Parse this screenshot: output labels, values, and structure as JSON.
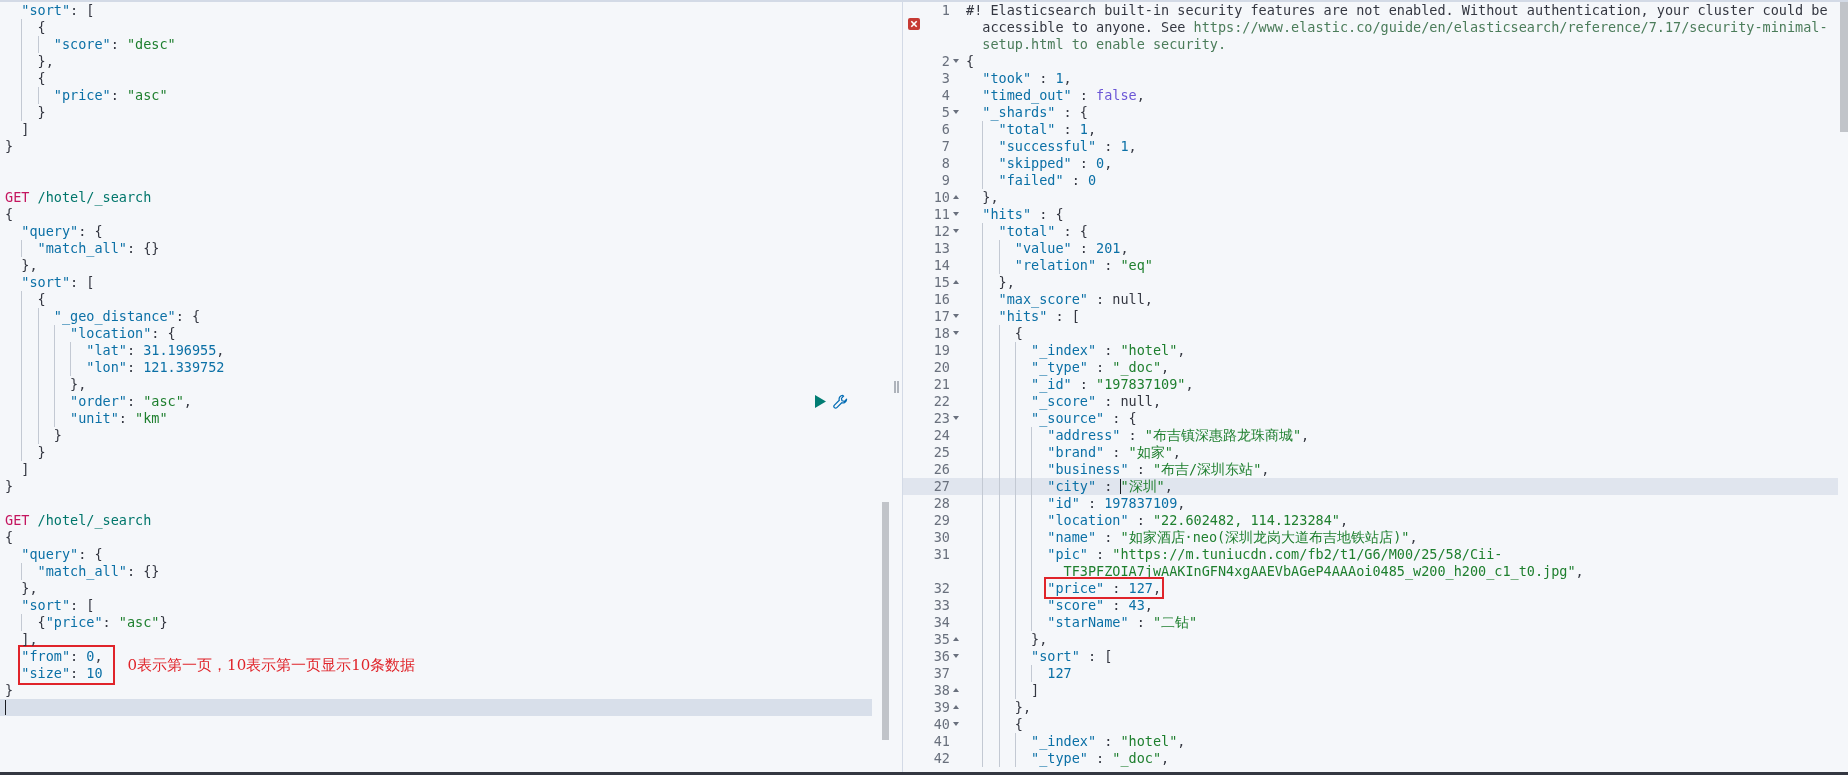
{
  "request_editor": {
    "note": "0表示第一页，10表示第一页显示10条数据",
    "lines": [
      {
        "current": false,
        "tokens": [
          {
            "kind": "key",
            "text": "  \"sort\""
          },
          {
            "kind": "punct",
            "text": ": ["
          }
        ]
      },
      {
        "current": false,
        "tokens": [
          {
            "kind": "punct",
            "text": "    {"
          }
        ]
      },
      {
        "current": false,
        "tokens": [
          {
            "kind": "key",
            "text": "      \"score\""
          },
          {
            "kind": "punct",
            "text": ": "
          },
          {
            "kind": "string",
            "text": "\"desc\""
          }
        ]
      },
      {
        "current": false,
        "tokens": [
          {
            "kind": "punct",
            "text": "    },"
          }
        ]
      },
      {
        "current": false,
        "tokens": [
          {
            "kind": "punct",
            "text": "    {"
          }
        ]
      },
      {
        "current": false,
        "tokens": [
          {
            "kind": "key",
            "text": "      \"price\""
          },
          {
            "kind": "punct",
            "text": ": "
          },
          {
            "kind": "string",
            "text": "\"asc\""
          }
        ]
      },
      {
        "current": false,
        "tokens": [
          {
            "kind": "punct",
            "text": "    }"
          }
        ]
      },
      {
        "current": false,
        "tokens": [
          {
            "kind": "punct",
            "text": "  ]"
          }
        ]
      },
      {
        "current": false,
        "tokens": [
          {
            "kind": "punct",
            "text": "}"
          }
        ]
      },
      {
        "current": false
      },
      {
        "current": false
      },
      {
        "current": false,
        "tokens": [
          {
            "kind": "method",
            "text": "GET"
          },
          {
            "kind": "path",
            "text": " /hotel/_search"
          }
        ]
      },
      {
        "current": false,
        "tokens": [
          {
            "kind": "punct",
            "text": "{"
          }
        ]
      },
      {
        "current": false,
        "tokens": [
          {
            "kind": "key",
            "text": "  \"query\""
          },
          {
            "kind": "punct",
            "text": ": {"
          }
        ]
      },
      {
        "current": false,
        "tokens": [
          {
            "kind": "key",
            "text": "    \"match_all\""
          },
          {
            "kind": "punct",
            "text": ": {}"
          }
        ]
      },
      {
        "current": false,
        "tokens": [
          {
            "kind": "punct",
            "text": "  },"
          }
        ]
      },
      {
        "current": false,
        "tokens": [
          {
            "kind": "key",
            "text": "  \"sort\""
          },
          {
            "kind": "punct",
            "text": ": ["
          }
        ]
      },
      {
        "current": false,
        "tokens": [
          {
            "kind": "punct",
            "text": "    {"
          }
        ]
      },
      {
        "current": false,
        "tokens": [
          {
            "kind": "key",
            "text": "      \"_geo_distance\""
          },
          {
            "kind": "punct",
            "text": ": {"
          }
        ]
      },
      {
        "current": false,
        "tokens": [
          {
            "kind": "key",
            "text": "        \"location\""
          },
          {
            "kind": "punct",
            "text": ": {"
          }
        ]
      },
      {
        "current": false,
        "tokens": [
          {
            "kind": "key",
            "text": "          \"lat\""
          },
          {
            "kind": "punct",
            "text": ": "
          },
          {
            "kind": "number",
            "text": "31.196955"
          },
          {
            "kind": "punct",
            "text": ","
          }
        ]
      },
      {
        "current": false,
        "tokens": [
          {
            "kind": "key",
            "text": "          \"lon\""
          },
          {
            "kind": "punct",
            "text": ": "
          },
          {
            "kind": "number",
            "text": "121.339752"
          }
        ]
      },
      {
        "current": false,
        "tokens": [
          {
            "kind": "punct",
            "text": "        },"
          }
        ]
      },
      {
        "current": false,
        "actions": true,
        "tokens": [
          {
            "kind": "key",
            "text": "        \"order\""
          },
          {
            "kind": "punct",
            "text": ": "
          },
          {
            "kind": "string",
            "text": "\"asc\""
          },
          {
            "kind": "punct",
            "text": ","
          }
        ]
      },
      {
        "current": false,
        "tokens": [
          {
            "kind": "key",
            "text": "        \"unit\""
          },
          {
            "kind": "punct",
            "text": ": "
          },
          {
            "kind": "string",
            "text": "\"km\""
          }
        ]
      },
      {
        "current": false,
        "tokens": [
          {
            "kind": "punct",
            "text": "      }"
          }
        ]
      },
      {
        "current": false,
        "tokens": [
          {
            "kind": "punct",
            "text": "    }"
          }
        ]
      },
      {
        "current": false,
        "tokens": [
          {
            "kind": "punct",
            "text": "  ]"
          }
        ]
      },
      {
        "current": false,
        "tokens": [
          {
            "kind": "punct",
            "text": "}"
          }
        ]
      },
      {
        "current": false
      },
      {
        "current": false,
        "tokens": [
          {
            "kind": "method",
            "text": "GET"
          },
          {
            "kind": "path",
            "text": " /hotel/_search"
          }
        ]
      },
      {
        "current": false,
        "tokens": [
          {
            "kind": "punct",
            "text": "{"
          }
        ]
      },
      {
        "current": false,
        "tokens": [
          {
            "kind": "key",
            "text": "  \"query\""
          },
          {
            "kind": "punct",
            "text": ": {"
          }
        ]
      },
      {
        "current": false,
        "tokens": [
          {
            "kind": "key",
            "text": "    \"match_all\""
          },
          {
            "kind": "punct",
            "text": ": {}"
          }
        ]
      },
      {
        "current": false,
        "tokens": [
          {
            "kind": "punct",
            "text": "  },"
          }
        ]
      },
      {
        "current": false,
        "tokens": [
          {
            "kind": "key",
            "text": "  \"sort\""
          },
          {
            "kind": "punct",
            "text": ": ["
          }
        ]
      },
      {
        "current": false,
        "tokens": [
          {
            "kind": "punct",
            "text": "    {"
          },
          {
            "kind": "key",
            "text": "\"price\""
          },
          {
            "kind": "punct",
            "text": ": "
          },
          {
            "kind": "string",
            "text": "\"asc\""
          },
          {
            "kind": "punct",
            "text": "}"
          }
        ]
      },
      {
        "current": false,
        "tokens": [
          {
            "kind": "punct",
            "text": "  ],"
          }
        ]
      },
      {
        "current": false,
        "marked": true,
        "tokens": [
          {
            "kind": "key",
            "text": "  \"from\""
          },
          {
            "kind": "punct",
            "text": ": "
          },
          {
            "kind": "number",
            "text": "0"
          },
          {
            "kind": "punct",
            "text": ","
          }
        ]
      },
      {
        "current": false,
        "marked": true,
        "tokens": [
          {
            "kind": "key",
            "text": "  \"size\""
          },
          {
            "kind": "punct",
            "text": ": "
          },
          {
            "kind": "number",
            "text": "10"
          }
        ]
      },
      {
        "current": false,
        "tokens": [
          {
            "kind": "punct",
            "text": "}"
          }
        ]
      },
      {
        "current": true
      }
    ]
  },
  "response_viewer": {
    "lines": [
      {
        "number": "1",
        "current": false,
        "error": true,
        "tokens": [
          {
            "kind": "plain",
            "text": "#! Elasticsearch built-in security features are not enabled. Without authentication, your cluster could be accessible to anyone. See "
          },
          {
            "kind": "link",
            "text": "https://www.elastic.co/guide/en/elasticsearch/reference/7.17/security-minimal-setup.html to enable security."
          }
        ]
      },
      {
        "number": "2",
        "current": false,
        "fold_start": true,
        "tokens": [
          {
            "kind": "punct",
            "text": "{"
          }
        ]
      },
      {
        "number": "3",
        "current": false,
        "tokens": [
          {
            "kind": "key",
            "text": "  \"took\""
          },
          {
            "kind": "punct",
            "text": " : "
          },
          {
            "kind": "number",
            "text": "1"
          },
          {
            "kind": "punct",
            "text": ","
          }
        ]
      },
      {
        "number": "4",
        "current": false,
        "tokens": [
          {
            "kind": "key",
            "text": "  \"timed_out\""
          },
          {
            "kind": "punct",
            "text": " : "
          },
          {
            "kind": "bool",
            "text": "false"
          },
          {
            "kind": "punct",
            "text": ","
          }
        ]
      },
      {
        "number": "5",
        "current": false,
        "fold_start": true,
        "tokens": [
          {
            "kind": "key",
            "text": "  \"_shards\""
          },
          {
            "kind": "punct",
            "text": " : {"
          }
        ]
      },
      {
        "number": "6",
        "current": false,
        "tokens": [
          {
            "kind": "key",
            "text": "    \"total\""
          },
          {
            "kind": "punct",
            "text": " : "
          },
          {
            "kind": "number",
            "text": "1"
          },
          {
            "kind": "punct",
            "text": ","
          }
        ]
      },
      {
        "number": "7",
        "current": false,
        "tokens": [
          {
            "kind": "key",
            "text": "    \"successful\""
          },
          {
            "kind": "punct",
            "text": " : "
          },
          {
            "kind": "number",
            "text": "1"
          },
          {
            "kind": "punct",
            "text": ","
          }
        ]
      },
      {
        "number": "8",
        "current": false,
        "tokens": [
          {
            "kind": "key",
            "text": "    \"skipped\""
          },
          {
            "kind": "punct",
            "text": " : "
          },
          {
            "kind": "number",
            "text": "0"
          },
          {
            "kind": "punct",
            "text": ","
          }
        ]
      },
      {
        "number": "9",
        "current": false,
        "tokens": [
          {
            "kind": "key",
            "text": "    \"failed\""
          },
          {
            "kind": "punct",
            "text": " : "
          },
          {
            "kind": "number",
            "text": "0"
          }
        ]
      },
      {
        "number": "10",
        "current": false,
        "fold_end": true,
        "tokens": [
          {
            "kind": "punct",
            "text": "  },"
          }
        ]
      },
      {
        "number": "11",
        "current": false,
        "fold_start": true,
        "tokens": [
          {
            "kind": "key",
            "text": "  \"hits\""
          },
          {
            "kind": "punct",
            "text": " : {"
          }
        ]
      },
      {
        "number": "12",
        "current": false,
        "fold_start": true,
        "tokens": [
          {
            "kind": "key",
            "text": "    \"total\""
          },
          {
            "kind": "punct",
            "text": " : {"
          }
        ]
      },
      {
        "number": "13",
        "current": false,
        "tokens": [
          {
            "kind": "key",
            "text": "      \"value\""
          },
          {
            "kind": "punct",
            "text": " : "
          },
          {
            "kind": "number",
            "text": "201"
          },
          {
            "kind": "punct",
            "text": ","
          }
        ]
      },
      {
        "number": "14",
        "current": false,
        "tokens": [
          {
            "kind": "key",
            "text": "      \"relation\""
          },
          {
            "kind": "punct",
            "text": " : "
          },
          {
            "kind": "string",
            "text": "\"eq\""
          }
        ]
      },
      {
        "number": "15",
        "current": false,
        "fold_end": true,
        "tokens": [
          {
            "kind": "punct",
            "text": "    },"
          }
        ]
      },
      {
        "number": "16",
        "current": false,
        "tokens": [
          {
            "kind": "key",
            "text": "    \"max_score\""
          },
          {
            "kind": "punct",
            "text": " : null,"
          }
        ]
      },
      {
        "number": "17",
        "current": false,
        "fold_start": true,
        "tokens": [
          {
            "kind": "key",
            "text": "    \"hits\""
          },
          {
            "kind": "punct",
            "text": " : ["
          }
        ]
      },
      {
        "number": "18",
        "current": false,
        "fold_start": true,
        "tokens": [
          {
            "kind": "punct",
            "text": "      {"
          }
        ]
      },
      {
        "number": "19",
        "current": false,
        "tokens": [
          {
            "kind": "key",
            "text": "        \"_index\""
          },
          {
            "kind": "punct",
            "text": " : "
          },
          {
            "kind": "string",
            "text": "\"hotel\""
          },
          {
            "kind": "punct",
            "text": ","
          }
        ]
      },
      {
        "number": "20",
        "current": false,
        "tokens": [
          {
            "kind": "key",
            "text": "        \"_type\""
          },
          {
            "kind": "punct",
            "text": " : "
          },
          {
            "kind": "string",
            "text": "\"_doc\""
          },
          {
            "kind": "punct",
            "text": ","
          }
        ]
      },
      {
        "number": "21",
        "current": false,
        "tokens": [
          {
            "kind": "key",
            "text": "        \"_id\""
          },
          {
            "kind": "punct",
            "text": " : "
          },
          {
            "kind": "string",
            "text": "\"197837109\""
          },
          {
            "kind": "punct",
            "text": ","
          }
        ]
      },
      {
        "number": "22",
        "current": false,
        "tokens": [
          {
            "kind": "key",
            "text": "        \"_score\""
          },
          {
            "kind": "punct",
            "text": " : null,"
          }
        ]
      },
      {
        "number": "23",
        "current": false,
        "fold_start": true,
        "tokens": [
          {
            "kind": "key",
            "text": "        \"_source\""
          },
          {
            "kind": "punct",
            "text": " : {"
          }
        ]
      },
      {
        "number": "24",
        "current": false,
        "tokens": [
          {
            "kind": "key",
            "text": "          \"address\""
          },
          {
            "kind": "punct",
            "text": " : "
          },
          {
            "kind": "string",
            "text": "\"布吉镇深惠路龙珠商城\""
          },
          {
            "kind": "punct",
            "text": ","
          }
        ]
      },
      {
        "number": "25",
        "current": false,
        "tokens": [
          {
            "kind": "key",
            "text": "          \"brand\""
          },
          {
            "kind": "punct",
            "text": " : "
          },
          {
            "kind": "string",
            "text": "\"如家\""
          },
          {
            "kind": "punct",
            "text": ","
          }
        ]
      },
      {
        "number": "26",
        "current": false,
        "tokens": [
          {
            "kind": "key",
            "text": "          \"business\""
          },
          {
            "kind": "punct",
            "text": " : "
          },
          {
            "kind": "string",
            "text": "\"布吉/深圳东站\""
          },
          {
            "kind": "punct",
            "text": ","
          }
        ]
      },
      {
        "number": "27",
        "current": true,
        "tokens": [
          {
            "kind": "key",
            "text": "          \"city\""
          },
          {
            "kind": "punct",
            "text": " : "
          },
          {
            "kind": "string",
            "text": "\"深圳\"",
            "cursor": true
          },
          {
            "kind": "punct",
            "text": ","
          }
        ]
      },
      {
        "number": "28",
        "current": false,
        "tokens": [
          {
            "kind": "key",
            "text": "          \"id\""
          },
          {
            "kind": "punct",
            "text": " : "
          },
          {
            "kind": "number",
            "text": "197837109"
          },
          {
            "kind": "punct",
            "text": ","
          }
        ]
      },
      {
        "number": "29",
        "current": false,
        "tokens": [
          {
            "kind": "key",
            "text": "          \"location\""
          },
          {
            "kind": "punct",
            "text": " : "
          },
          {
            "kind": "string",
            "text": "\"22.602482, 114.123284\""
          },
          {
            "kind": "punct",
            "text": ","
          }
        ]
      },
      {
        "number": "30",
        "current": false,
        "tokens": [
          {
            "kind": "key",
            "text": "          \"name\""
          },
          {
            "kind": "punct",
            "text": " : "
          },
          {
            "kind": "string",
            "text": "\"如家酒店·neo(深圳龙岗大道布吉地铁站店)\""
          },
          {
            "kind": "punct",
            "text": ","
          }
        ]
      },
      {
        "number": "31",
        "current": false,
        "tokens": [
          {
            "kind": "key",
            "text": "          \"pic\""
          },
          {
            "kind": "punct",
            "text": " : "
          },
          {
            "kind": "string",
            "text": "\"https://m.tuniucdn.com/fb2/t1/G6/M00/25/58/Cii-TF3PFZOIA7jwAAKInGFN4xgAAEVbAGeP4AAAoi0485_w200_h200_c1_t0.jpg\""
          },
          {
            "kind": "punct",
            "text": ","
          }
        ]
      },
      {
        "number": "32",
        "current": false,
        "marked": true,
        "tokens": [
          {
            "kind": "key",
            "text": "          \"price\""
          },
          {
            "kind": "punct",
            "text": " : "
          },
          {
            "kind": "number",
            "text": "127"
          },
          {
            "kind": "punct",
            "text": ","
          }
        ]
      },
      {
        "number": "33",
        "current": false,
        "tokens": [
          {
            "kind": "key",
            "text": "          \"score\""
          },
          {
            "kind": "punct",
            "text": " : "
          },
          {
            "kind": "number",
            "text": "43"
          },
          {
            "kind": "punct",
            "text": ","
          }
        ]
      },
      {
        "number": "34",
        "current": false,
        "tokens": [
          {
            "kind": "key",
            "text": "          \"starName\""
          },
          {
            "kind": "punct",
            "text": " : "
          },
          {
            "kind": "string",
            "text": "\"二钻\""
          }
        ]
      },
      {
        "number": "35",
        "current": false,
        "fold_end": true,
        "tokens": [
          {
            "kind": "punct",
            "text": "        },"
          }
        ]
      },
      {
        "number": "36",
        "current": false,
        "fold_start": true,
        "tokens": [
          {
            "kind": "key",
            "text": "        \"sort\""
          },
          {
            "kind": "punct",
            "text": " : ["
          }
        ]
      },
      {
        "number": "37",
        "current": false,
        "tokens": [
          {
            "kind": "number",
            "text": "          127"
          }
        ]
      },
      {
        "number": "38",
        "current": false,
        "fold_end": true,
        "tokens": [
          {
            "kind": "punct",
            "text": "        ]"
          }
        ]
      },
      {
        "number": "39",
        "current": false,
        "fold_end": true,
        "tokens": [
          {
            "kind": "punct",
            "text": "      },"
          }
        ]
      },
      {
        "number": "40",
        "current": false,
        "fold_start": true,
        "tokens": [
          {
            "kind": "punct",
            "text": "      {"
          }
        ]
      },
      {
        "number": "41",
        "current": false,
        "tokens": [
          {
            "kind": "key",
            "text": "        \"_index\""
          },
          {
            "kind": "punct",
            "text": " : "
          },
          {
            "kind": "string",
            "text": "\"hotel\""
          },
          {
            "kind": "punct",
            "text": ","
          }
        ]
      },
      {
        "number": "42",
        "current": false,
        "tokens": [
          {
            "kind": "key",
            "text": "        \"_type\""
          },
          {
            "kind": "punct",
            "text": " : "
          },
          {
            "kind": "string",
            "text": "\"_doc\""
          },
          {
            "kind": "punct",
            "text": ","
          }
        ]
      }
    ]
  }
}
